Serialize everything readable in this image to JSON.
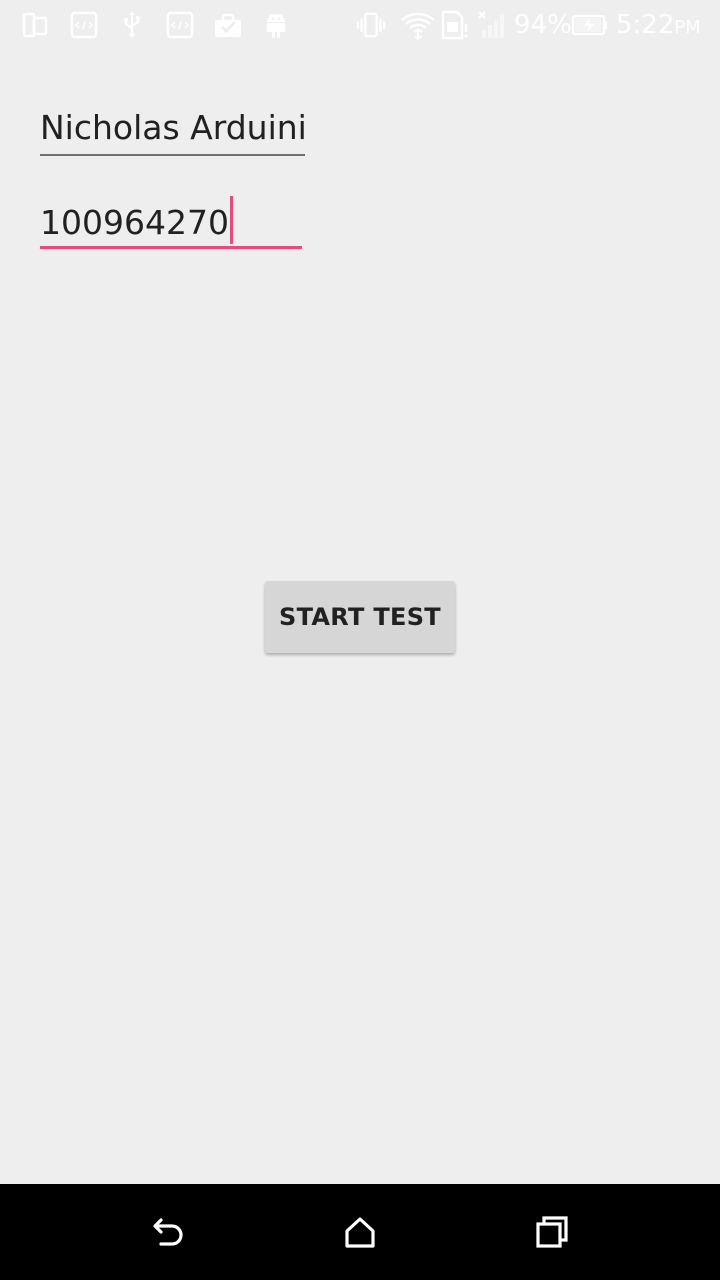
{
  "status_bar": {
    "battery_percent": "94%",
    "time": "5:22",
    "ampm": "PM",
    "icon_color": "#ffffff",
    "icons_left": [
      "dual-screen-icon",
      "code-icon",
      "usb-icon",
      "code-icon",
      "briefcase-check-icon",
      "android-icon"
    ],
    "icons_right": [
      "vibrate-icon",
      "wifi-icon",
      "sim-alert-icon",
      "no-signal-icon",
      "battery-charging-icon"
    ]
  },
  "form": {
    "name_value": "Nicholas Arduini",
    "id_value": "100964270"
  },
  "button": {
    "start_label": "START TEST"
  },
  "nav": {
    "icons": [
      "back-icon",
      "home-icon",
      "recents-icon"
    ]
  },
  "colors": {
    "background": "#eeeeee",
    "accent": "#e84a7f",
    "button_bg": "#d6d6d6",
    "nav_bg": "#000000"
  }
}
